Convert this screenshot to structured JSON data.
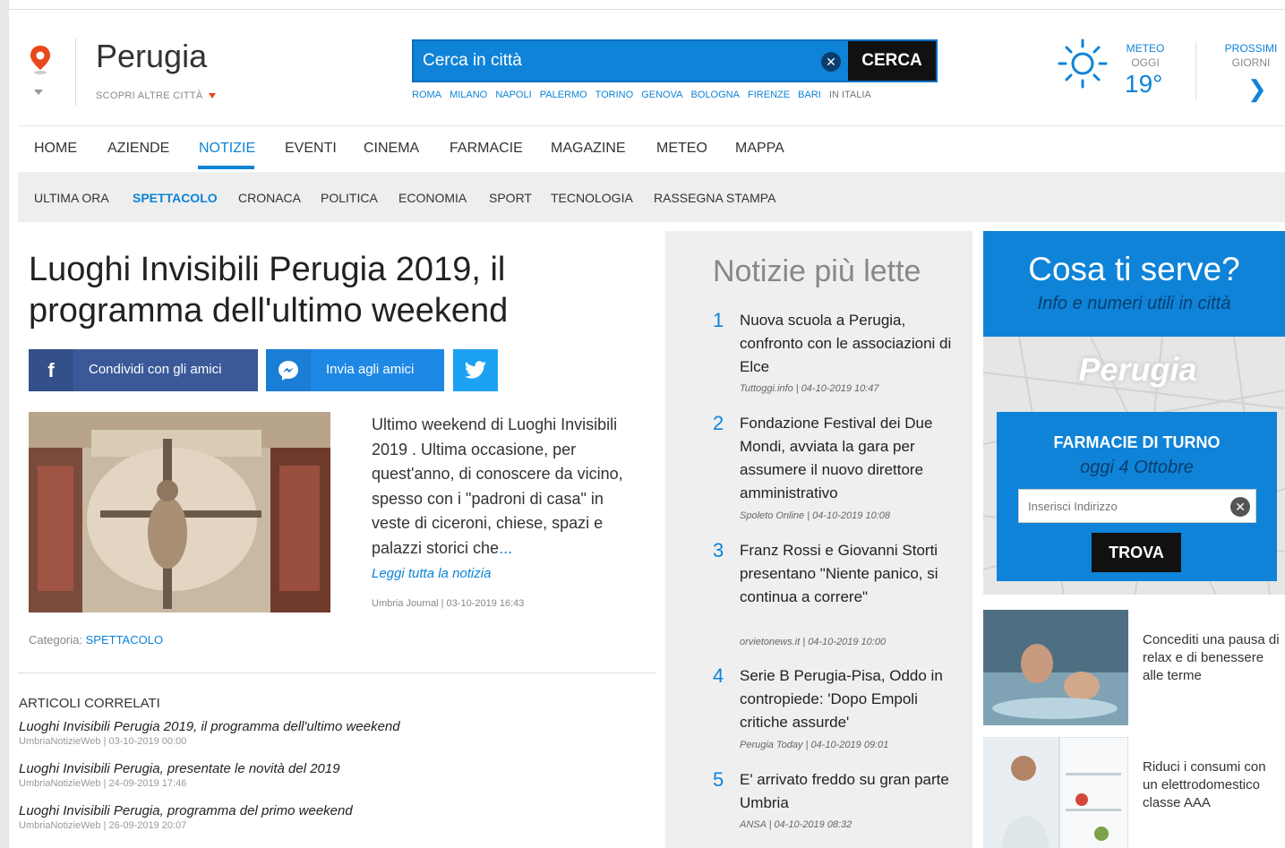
{
  "colors": {
    "accent": "#0e83d8",
    "dark": "#111111",
    "facebook": "#3b5998",
    "twitter": "#1da1f2",
    "pin": "#e8481c"
  },
  "header": {
    "city": "Perugia",
    "altre_citta": "SCOPRI ALTRE CITTÀ",
    "search": {
      "placeholder": "Cerca in città",
      "button": "CERCA"
    },
    "city_links": [
      "ROMA",
      "MILANO",
      "NAPOLI",
      "PALERMO",
      "TORINO",
      "GENOVA",
      "BOLOGNA",
      "FIRENZE",
      "BARI"
    ],
    "in_italia": "IN ITALIA",
    "meteo": {
      "label1": "METEO",
      "label2": "OGGI",
      "temp": "19°",
      "icon": "sun-icon"
    },
    "prossimi": {
      "label1": "PROSSIMI",
      "label2": "GIORNI",
      "icon": "chevron-right-icon"
    }
  },
  "nav": [
    "HOME",
    "AZIENDE",
    "NOTIZIE",
    "EVENTI",
    "CINEMA",
    "FARMACIE",
    "MAGAZINE",
    "METEO",
    "MAPPA"
  ],
  "subnav": [
    "ULTIMA ORA",
    "SPETTACOLO",
    "CRONACA",
    "POLITICA",
    "ECONOMIA",
    "SPORT",
    "TECNOLOGIA",
    "RASSEGNA STAMPA"
  ],
  "article": {
    "title": "Luoghi Invisibili Perugia 2019, il programma dell'ultimo weekend",
    "share_fb": "Condividi con gli amici",
    "share_msg": "Invia agli amici",
    "summary": "Ultimo weekend di Luoghi Invisibili 2019 . Ultima occasione, per quest'anno, di conoscere da vicino, spesso con i \"padroni di casa\" in veste di ciceroni, chiese, spazi e palazzi storici che",
    "ellipsis": "...",
    "read_more": "Leggi tutta la notizia",
    "source": "Umbria Journal | 03-10-2019 16:43",
    "category_label": "Categoria:",
    "category": "SPETTACOLO"
  },
  "related": {
    "heading": "ARTICOLI CORRELATI",
    "items": [
      {
        "title": "Luoghi Invisibili Perugia 2019, il programma dell'ultimo weekend",
        "source": "UmbriaNotizieWeb | 03-10-2019 00:00"
      },
      {
        "title": "Luoghi Invisibili Perugia, presentate le novità del 2019",
        "source": "UmbriaNotizieWeb | 24-09-2019 17:46"
      },
      {
        "title": "Luoghi Invisibili Perugia, programma del primo weekend",
        "source": "UmbriaNotizieWeb | 26-09-2019 20:07"
      }
    ]
  },
  "most_read": {
    "heading": "Notizie più lette",
    "items": [
      {
        "n": "1",
        "title": "Nuova scuola a Perugia, confronto con le associazioni di Elce",
        "source": "Tuttoggi.info | 04-10-2019 10:47"
      },
      {
        "n": "2",
        "title": "Fondazione Festival dei Due Mondi, avviata la gara per assumere il nuovo direttore amministrativo",
        "source": "Spoleto Online | 04-10-2019 10:08"
      },
      {
        "n": "3",
        "title": "Franz Rossi e Giovanni Storti presentano \"Niente panico, si continua a correre\"",
        "source": "orvietonews.it | 04-10-2019 10:00"
      },
      {
        "n": "4",
        "title": "Serie B Perugia-Pisa, Oddo in contropiede: 'Dopo Empoli critiche assurde'",
        "source": "Perugia Today | 04-10-2019 09:01"
      },
      {
        "n": "5",
        "title": "E' arrivato freddo su gran parte Umbria",
        "source": "ANSA | 04-10-2019 08:32"
      }
    ]
  },
  "sidebar": {
    "cosa_title": "Cosa ti serve?",
    "cosa_sub": "Info e numeri utili in città",
    "map_city": "Perugia",
    "farmacie_title": "FARMACIE DI TURNO",
    "farmacie_date": "oggi 4 Ottobre",
    "addr_placeholder": "Inserisci Indirizzo",
    "trova": "TROVA",
    "ads": [
      {
        "text": "Concediti una pausa di relax e di benessere alle terme"
      },
      {
        "text": "Riduci i consumi con un elettrodomestico classe AAA"
      }
    ]
  }
}
